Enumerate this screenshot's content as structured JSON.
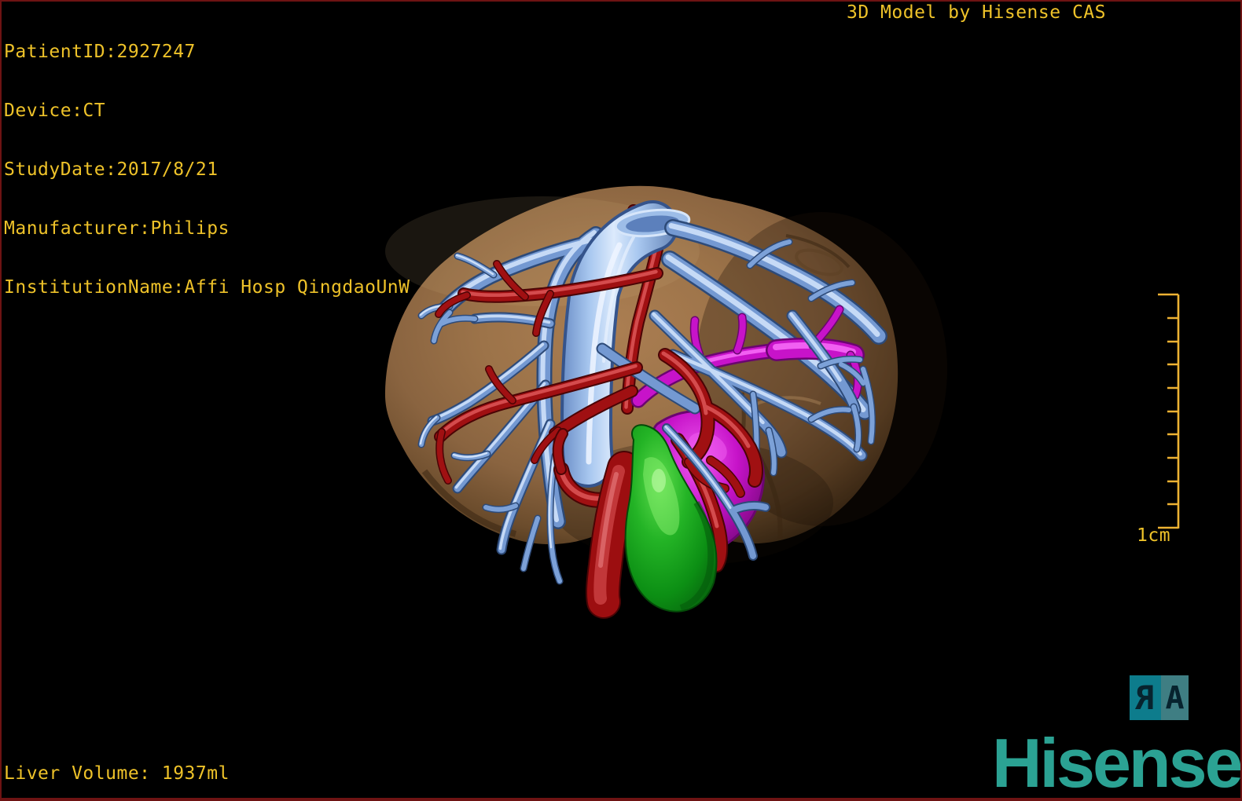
{
  "header": {
    "patient_lines": [
      "PatientID:2927247",
      "Device:CT",
      "StudyDate:2017/8/21",
      "Manufacturer:Philips",
      "InstitutionName:Affi Hosp QingdaoUnW"
    ],
    "app_title": "3D Model by Hisense CAS"
  },
  "footer": {
    "liver_volume_label": "Liver Volume:",
    "liver_volume_value": " 1937ml",
    "brand_logo": "Hisense"
  },
  "scale_bar": {
    "label": "1cm",
    "tick_count": 11
  },
  "orientation": {
    "right_label": "R",
    "anterior_label": "A"
  },
  "model": {
    "structures": [
      {
        "name": "liver",
        "color": "#9c7349"
      },
      {
        "name": "hepatic-veins-ivc",
        "color": "#7499d2"
      },
      {
        "name": "hepatic-artery",
        "color": "#a01012"
      },
      {
        "name": "portal-vein",
        "color": "#c713c9"
      },
      {
        "name": "gallbladder",
        "color": "#16a021"
      }
    ]
  },
  "colors": {
    "background": "#000000",
    "overlay_text": "#eec229",
    "border": "#6e1313",
    "logo_teal": "#2ba293",
    "marker_teal": "#0d7c8c",
    "marker_muted": "#3f7e83",
    "scale_bar": "#edb233"
  }
}
